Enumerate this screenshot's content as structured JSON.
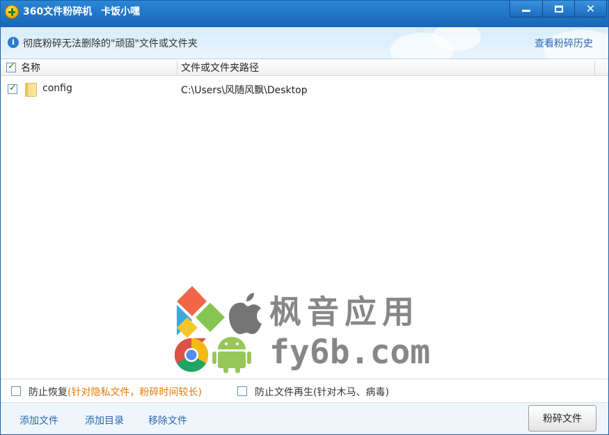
{
  "window": {
    "title": "360文件粉碎机",
    "subtitle": "卡饭小嘿"
  },
  "banner": {
    "text": "彻底粉碎无法删除的\"顽固\"文件或文件夹",
    "history_link": "查看粉碎历史"
  },
  "list": {
    "columns": [
      "名称",
      "文件或文件夹路径"
    ],
    "rows": [
      {
        "name": "config",
        "path": "C:\\Users\\风随风飘\\Desktop",
        "checked": true
      }
    ]
  },
  "watermark": {
    "text_cn": "枫音应用",
    "text_url": "fy6b.com"
  },
  "options": {
    "prevent_recovery": "防止恢复",
    "prevent_recovery_note": "针对隐私文件，粉碎时间较长",
    "prevent_regen": "防止文件再生",
    "prevent_regen_note": "(针对木马、病毒)"
  },
  "bottom": {
    "add_file": "添加文件",
    "add_dir": "添加目录",
    "remove_file": "移除文件",
    "shred_button": "粉碎文件"
  },
  "colors": {
    "titlebar": "#1f72c4",
    "link": "#2c67b0",
    "accent_orange": "#e87a00"
  }
}
